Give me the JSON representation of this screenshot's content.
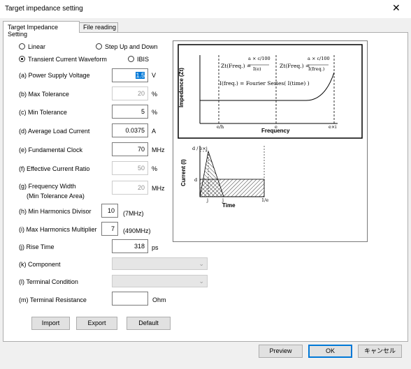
{
  "window": {
    "title": "Target impedance setting",
    "close_glyph": "✕"
  },
  "tabs": [
    "Target Impedance Setting",
    "File reading"
  ],
  "radios": {
    "linear": "Linear",
    "step": "Step Up and Down",
    "transient": "Transient Current Waveform",
    "ibis": "IBIS",
    "selected": "Transient Current Waveform"
  },
  "params": [
    {
      "label": "(a) Power Supply Voltage",
      "value": "1.5",
      "unit": "V",
      "enabled": true,
      "selected": true
    },
    {
      "label": "(b) Max Tolerance",
      "value": "20",
      "unit": "%",
      "enabled": false
    },
    {
      "label": "(c) Min Tolerance",
      "value": "5",
      "unit": "%",
      "enabled": true
    },
    {
      "label": "(d) Average Load Current",
      "value": "0.0375",
      "unit": "A",
      "enabled": true
    },
    {
      "label": "(e) Fundamental Clock",
      "value": "70",
      "unit": "MHz",
      "enabled": true
    },
    {
      "label": "(f) Effective Current Ratio",
      "value": "50",
      "unit": "%",
      "enabled": false
    },
    {
      "label": "(g) Frequency Width",
      "label2": "(Min Tolerance Area)",
      "value": "20",
      "unit": "MHz",
      "enabled": false
    },
    {
      "label": "(h) Min Harmonics Divisor",
      "value": "10",
      "unit": "(7MHz)",
      "enabled": true
    },
    {
      "label": "(i) Max Harmonics Multiplier",
      "value": "7",
      "unit": "(490MHz)",
      "enabled": true
    },
    {
      "label": "(j) Rise Time",
      "value": "318",
      "unit": "ps",
      "enabled": true
    }
  ],
  "component": {
    "label": "(k) Component",
    "value": ""
  },
  "terminal": {
    "label": "(l) Terminal Condition",
    "value": ""
  },
  "resistance": {
    "label": "(m) Terminal Resistance",
    "value": "",
    "unit": "Ohm"
  },
  "buttons": {
    "import": "Import",
    "export": "Export",
    "default": "Default"
  },
  "footer": {
    "preview": "Preview",
    "ok": "OK",
    "cancel": "キャンセル"
  },
  "graph_impedance": {
    "ylabel": "Impedance (Zt)",
    "xlabel": "Frequency",
    "eq1": "Zt(Freq.) =",
    "eq1_num": "a × c/100",
    "eq1_den": "I(e)",
    "eq2": "Zt(Freq.) =",
    "eq2_num": "a × c/100",
    "eq2_den": "I(freq.)",
    "eq3": "I(freq.) = Fourier Series( I(time) )",
    "ticks": [
      "e/h",
      "e",
      "e×i"
    ]
  },
  "graph_current": {
    "ylabel": "Current (I)",
    "xlabel": "Time",
    "peak_label": "d / e×j",
    "level_label": "d",
    "ticks": [
      "j",
      "j",
      "1/e"
    ]
  }
}
